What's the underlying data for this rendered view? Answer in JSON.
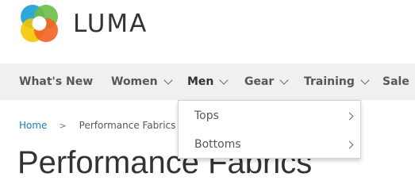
{
  "header": {
    "logo_text": "LUMA"
  },
  "nav": {
    "items": [
      {
        "label": "What's New",
        "has_submenu": false
      },
      {
        "label": "Women",
        "has_submenu": true
      },
      {
        "label": "Men",
        "has_submenu": true,
        "active": true
      },
      {
        "label": "Gear",
        "has_submenu": true
      },
      {
        "label": "Training",
        "has_submenu": true
      },
      {
        "label": "Sale",
        "has_submenu": false
      }
    ]
  },
  "dropdown": {
    "items": [
      {
        "label": "Tops",
        "has_submenu": true
      },
      {
        "label": "Bottoms",
        "has_submenu": true
      }
    ]
  },
  "breadcrumb": {
    "home": "Home",
    "separator": ">",
    "current": "Performance Fabrics"
  },
  "page": {
    "title": "Performance Fabrics"
  },
  "colors": {
    "link": "#1979c3",
    "nav_bg": "#f0f0f0",
    "logo_blue": "#1e9fd8",
    "logo_green": "#6cbd45",
    "logo_orange": "#f26322",
    "logo_yellow": "#f2c800"
  }
}
